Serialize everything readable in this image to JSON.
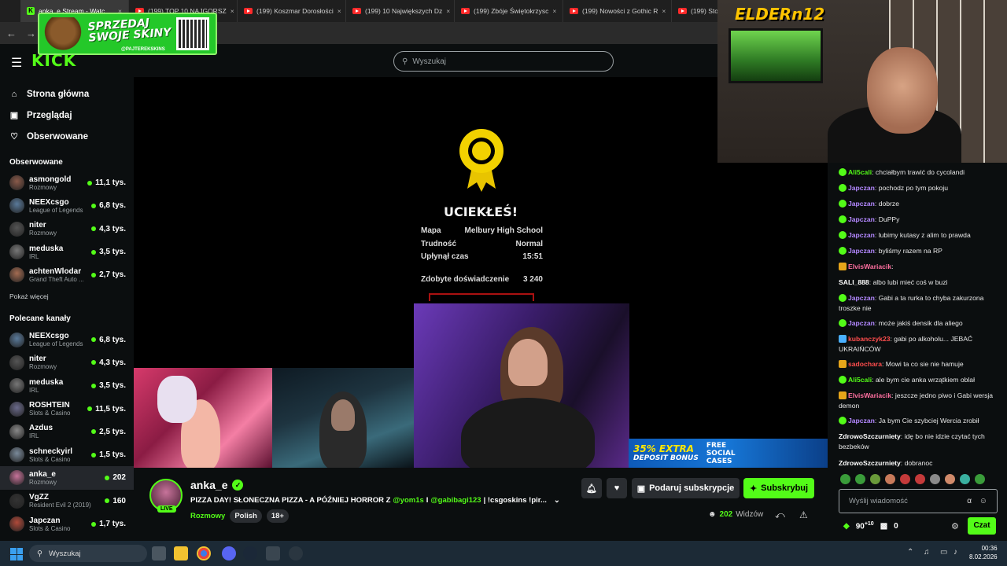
{
  "browser": {
    "tabs": [
      {
        "label": "anka_e Stream - Watc",
        "type": "kick"
      },
      {
        "label": "(199) TOP 10 NAJGORSZ",
        "type": "yt"
      },
      {
        "label": "(199) Koszmar Dorosłości",
        "type": "yt"
      },
      {
        "label": "(199) 10 Największych Dz",
        "type": "yt"
      },
      {
        "label": "(199) Zbóje Świętokrzysc",
        "type": "yt"
      },
      {
        "label": "(199) Nowości z Gothic R",
        "type": "yt"
      },
      {
        "label": "(199) Sto",
        "type": "yt"
      }
    ]
  },
  "overlay_ad": {
    "text_line1": "SPRZEDAJ",
    "text_line2": "SWOJE SKINY",
    "handle": "@PAJTEREKSKINS"
  },
  "header": {
    "logo": "KICK",
    "search_placeholder": "Wyszukaj"
  },
  "sidebar": {
    "nav": [
      {
        "label": "Strona główna",
        "icon": "home-icon"
      },
      {
        "label": "Przeglądaj",
        "icon": "browse-icon"
      },
      {
        "label": "Obserwowane",
        "icon": "heart-icon"
      }
    ],
    "followed_title": "Obserwowane",
    "followed": [
      {
        "name": "asmongold",
        "category": "Rozmowy",
        "viewers": "11,1 tys.",
        "color": "#8a5a4a"
      },
      {
        "name": "NEEXcsgo",
        "category": "League of Legends",
        "viewers": "6,8 tys.",
        "color": "#5a7a9a"
      },
      {
        "name": "niter",
        "category": "Rozmowy",
        "viewers": "4,3 tys.",
        "color": "#555"
      },
      {
        "name": "meduska",
        "category": "IRL",
        "viewers": "3,5 tys.",
        "color": "#777"
      },
      {
        "name": "achtenWlodar",
        "category": "Grand Theft Auto ...",
        "viewers": "2,7 tys.",
        "color": "#a46c52"
      }
    ],
    "show_more": "Pokaż więcej",
    "recommended_title": "Polecane kanały",
    "recommended": [
      {
        "name": "NEEXcsgo",
        "category": "League of Legends",
        "viewers": "6,8 tys.",
        "color": "#5a7a9a"
      },
      {
        "name": "niter",
        "category": "Rozmowy",
        "viewers": "4,3 tys.",
        "color": "#555"
      },
      {
        "name": "meduska",
        "category": "IRL",
        "viewers": "3,5 tys.",
        "color": "#777"
      },
      {
        "name": "ROSHTEIN",
        "category": "Slots & Casino",
        "viewers": "11,5 tys.",
        "color": "#6a6a8a"
      },
      {
        "name": "Azdus",
        "category": "IRL",
        "viewers": "2,5 tys.",
        "color": "#888"
      },
      {
        "name": "schneckyirl",
        "category": "Slots & Casino",
        "viewers": "1,5 tys.",
        "color": "#7a8a9a"
      },
      {
        "name": "anka_e",
        "category": "Rozmowy",
        "viewers": "202",
        "color": "#c7739a",
        "active": true
      },
      {
        "name": "VgZZ",
        "category": "Resident Evil 2 (2019)",
        "viewers": "160",
        "color": "#333"
      },
      {
        "name": "Japczan",
        "category": "Slots & Casino",
        "viewers": "1,7 tys.",
        "color": "#b04a3a"
      }
    ]
  },
  "game": {
    "title": "UCIEKŁEŚ!",
    "stats": [
      {
        "label": "Mapa",
        "value": "Melbury High School"
      },
      {
        "label": "Trudność",
        "value": "Normal"
      },
      {
        "label": "Upłynął czas",
        "value": "15:51"
      }
    ],
    "exp_label": "Zdobyte doświadczenie",
    "exp_value": "3 240"
  },
  "banner": {
    "text1": "35% EXTRA",
    "text2": "DEPOSIT BONUS",
    "text3": "FREE",
    "text4": "SOCIAL",
    "text5": "CASES"
  },
  "webcam_logo": "ELDERn12",
  "stream": {
    "name": "anka_e",
    "live_label": "LIVE",
    "title_prefix": "PIZZA DAY! SŁONECZNA PIZZA - A PÓŹNIEJ HORROR Z",
    "mention1": "@yom1s",
    "mention_sep": "I",
    "mention2": "@gabibagi123",
    "title_suffix": "| !csgoskins !pir...",
    "category": "Rozmowy",
    "tags": [
      "Polish",
      "18+"
    ],
    "gift_label": "Podaruj subskrypcje",
    "subscribe_label": "Subskrybuj",
    "viewers": "202",
    "viewers_label": "Widzów"
  },
  "chat": {
    "messages": [
      {
        "user": "Ali5cali",
        "color": "#53fc18",
        "badge": "green",
        "text": "chciałbym trawić do cycolandi"
      },
      {
        "user": "Japczan",
        "color": "#b388ff",
        "badge": "green",
        "text": "pochodz po tym pokoju"
      },
      {
        "user": "Japczan",
        "color": "#b388ff",
        "badge": "green",
        "text": "dobrze"
      },
      {
        "user": "Japczan",
        "color": "#b388ff",
        "badge": "green",
        "text": "DuPPy"
      },
      {
        "user": "Japczan",
        "color": "#b388ff",
        "badge": "green",
        "text": "lubimy kutasy z alim to prawda"
      },
      {
        "user": "Japczan",
        "color": "#b388ff",
        "badge": "green",
        "text": "byliśmy razem na RP"
      },
      {
        "user": "ElvisWariacik",
        "color": "#ff6fa0",
        "badge": "gold",
        "text": ""
      },
      {
        "user": "SALI_888",
        "color": "#ffffff",
        "badge": "",
        "text": "albo lubi mieć coś w buzi"
      },
      {
        "user": "Japczan",
        "color": "#b388ff",
        "badge": "green",
        "text": "Gabi a ta rurka to chyba zakurzona troszke nie"
      },
      {
        "user": "Japczan",
        "color": "#b388ff",
        "badge": "green",
        "text": "może jakiś densik dla aliego"
      },
      {
        "user": "kubanczyk23",
        "color": "#ff4d4d",
        "badge": "blue",
        "text": "gabi po alkoholu... JEBAĆ UKRAIŃCÓW"
      },
      {
        "user": "sadochara",
        "color": "#ff4d4d",
        "badge": "gold",
        "text": "Mowi ta co sie nie hamuje"
      },
      {
        "user": "Ali5cali",
        "color": "#53fc18",
        "badge": "green",
        "text": "ale bym cie anka wrzątkiem oblał"
      },
      {
        "user": "ElvisWariacik",
        "color": "#ff6fa0",
        "badge": "gold",
        "text": "jeszcze jedno piwo i Gabi wersja demon"
      },
      {
        "user": "Japczan",
        "color": "#b388ff",
        "badge": "green",
        "text": "Ja bym Cie szybciej Wercia zrobił"
      },
      {
        "user": "ZdrowoSzczurniety",
        "color": "#ffffff",
        "badge": "",
        "text": "idę bo nie idzie czytać tych bezbeków"
      },
      {
        "user": "ZdrowoSzczurniety",
        "color": "#ffffff",
        "badge": "",
        "text": "dobranoc"
      }
    ],
    "input_placeholder": "Wyślij wiadomość",
    "points": "90",
    "points_bonus": "+10",
    "drops": "0",
    "send_label": "Czat"
  },
  "taskbar": {
    "search_placeholder": "Wyszukaj",
    "time": "00:36",
    "date": "8.02.2026"
  }
}
